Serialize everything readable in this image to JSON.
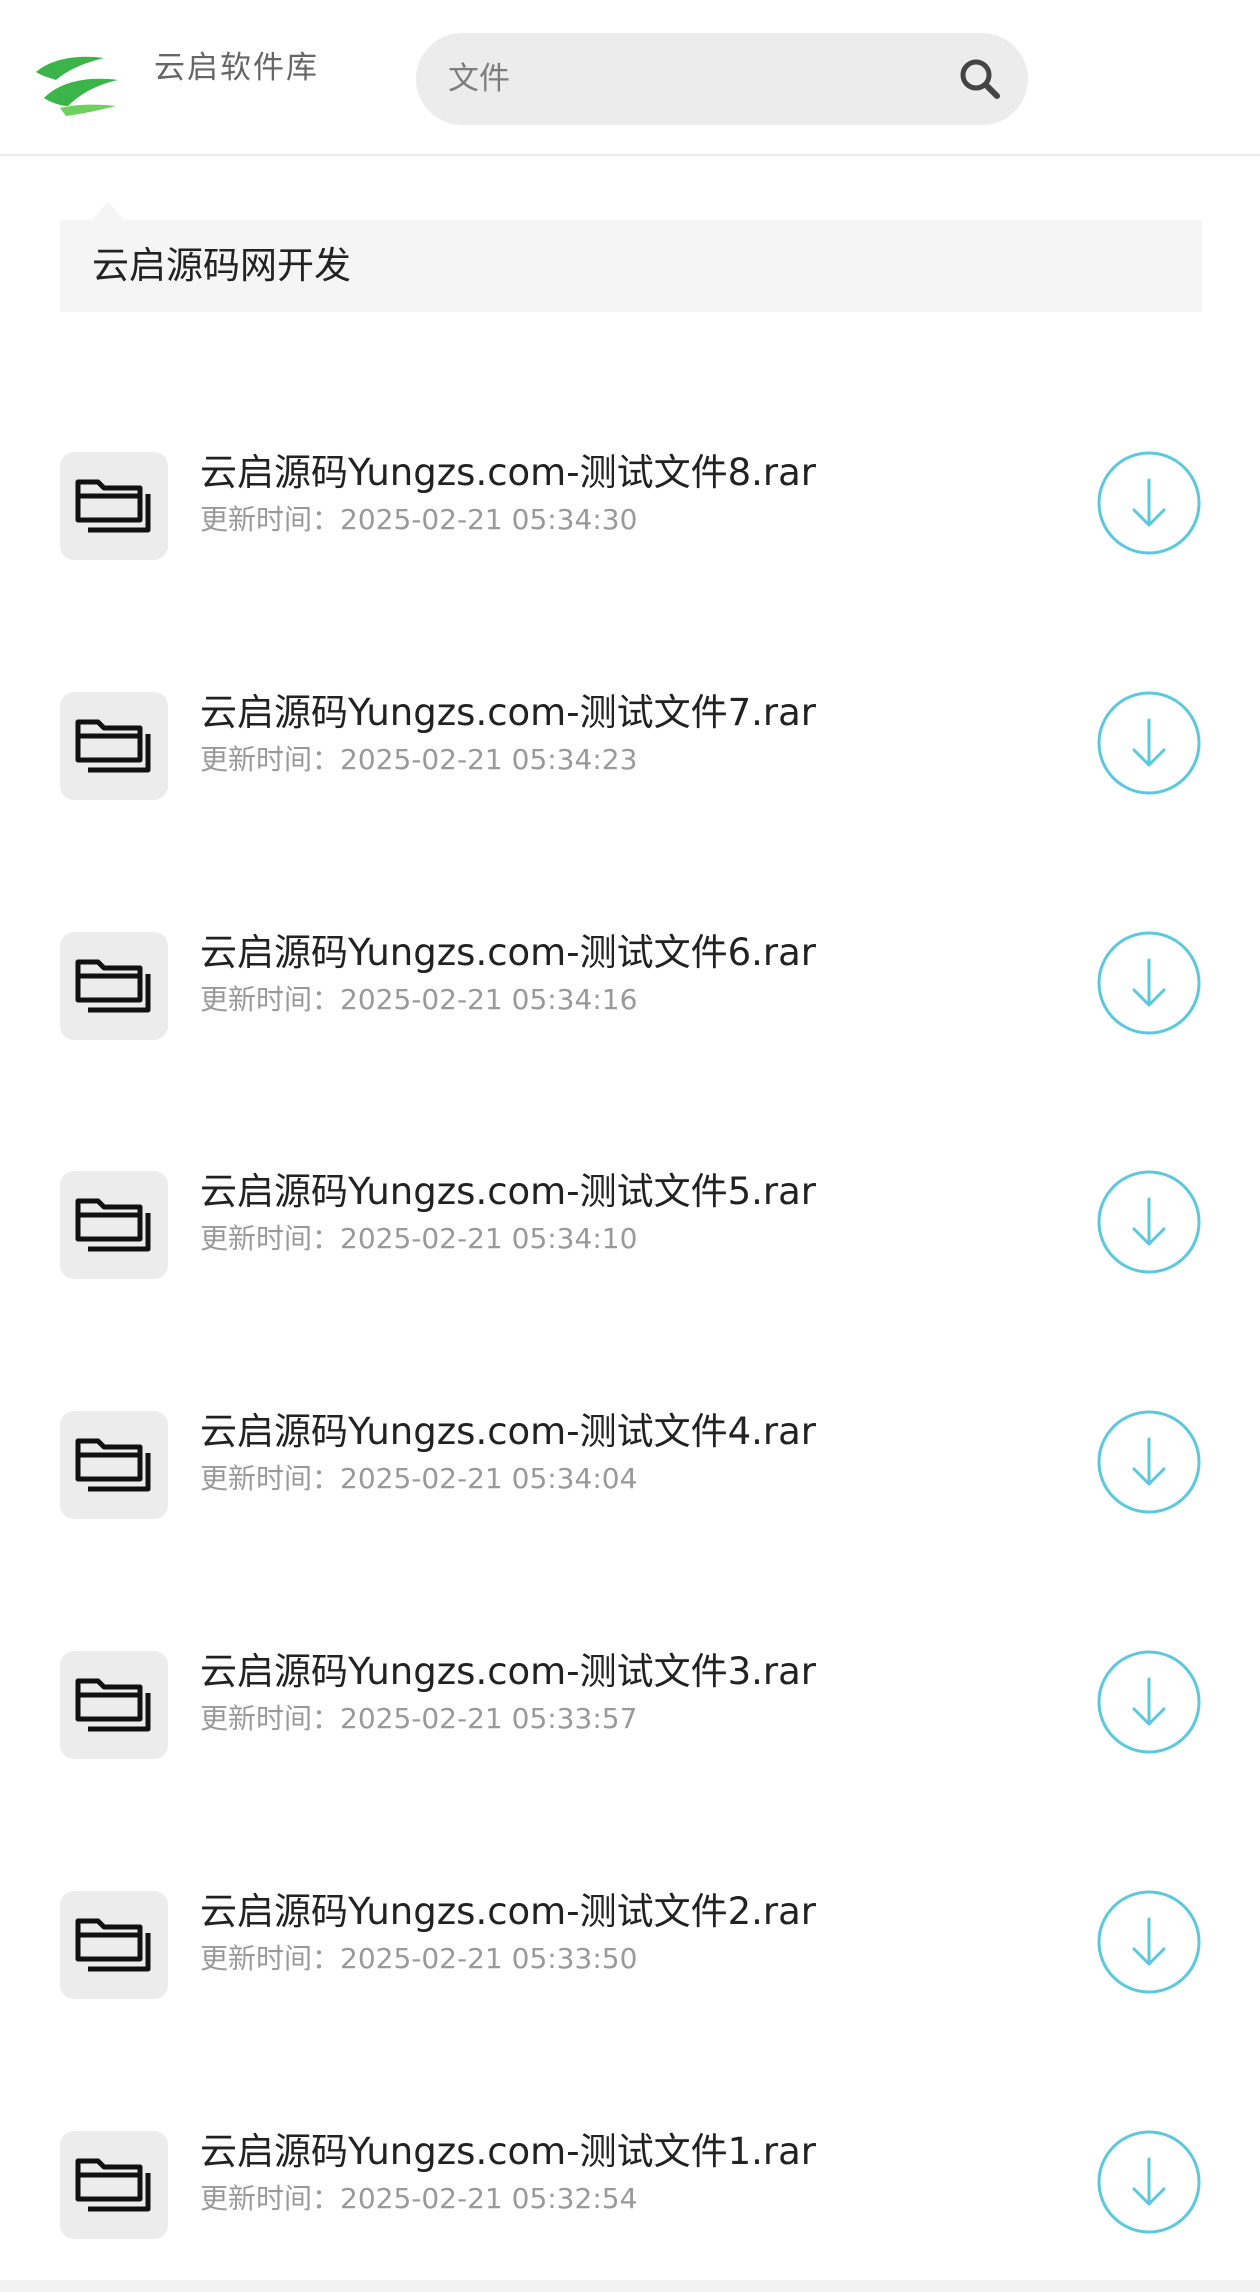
{
  "header": {
    "brand": "云启软件库",
    "search_value": "文件",
    "logo_color": "#3bb54a"
  },
  "breadcrumb": {
    "title": "云启源码网开发"
  },
  "accent_color": "#5bc8dc",
  "files": [
    {
      "name": "云启源码Yungzs.com-测试文件8.rar",
      "updated": "更新时间：2025-02-21 05:34:30"
    },
    {
      "name": "云启源码Yungzs.com-测试文件7.rar",
      "updated": "更新时间：2025-02-21 05:34:23"
    },
    {
      "name": "云启源码Yungzs.com-测试文件6.rar",
      "updated": "更新时间：2025-02-21 05:34:16"
    },
    {
      "name": "云启源码Yungzs.com-测试文件5.rar",
      "updated": "更新时间：2025-02-21 05:34:10"
    },
    {
      "name": "云启源码Yungzs.com-测试文件4.rar",
      "updated": "更新时间：2025-02-21 05:34:04"
    },
    {
      "name": "云启源码Yungzs.com-测试文件3.rar",
      "updated": "更新时间：2025-02-21 05:33:57"
    },
    {
      "name": "云启源码Yungzs.com-测试文件2.rar",
      "updated": "更新时间：2025-02-21 05:33:50"
    },
    {
      "name": "云启源码Yungzs.com-测试文件1.rar",
      "updated": "更新时间：2025-02-21 05:32:54"
    }
  ]
}
